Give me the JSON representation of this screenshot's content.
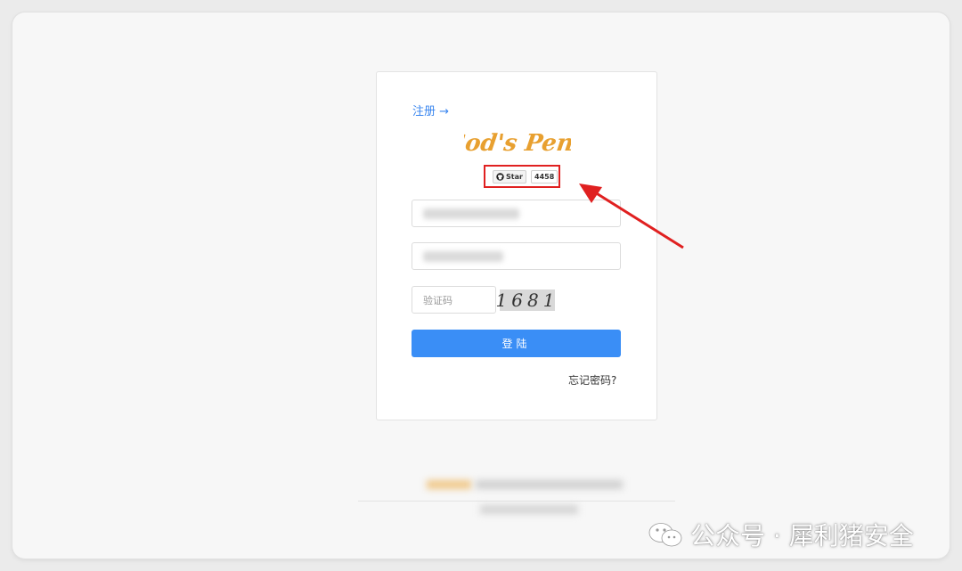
{
  "card": {
    "register_label": "注册 →",
    "logo_text": "God's Pen!",
    "github": {
      "star_label": "Star",
      "star_count": "4458"
    },
    "captcha": {
      "placeholder": "验证码",
      "code": "1681"
    },
    "login_label": "登陆",
    "forgot_label": "忘记密码?"
  },
  "watermark": {
    "text": "公众号 · 犀利猪安全"
  },
  "colors": {
    "accent": "#3a8ef6",
    "highlight": "#e02020",
    "logo": "#e8a030"
  }
}
